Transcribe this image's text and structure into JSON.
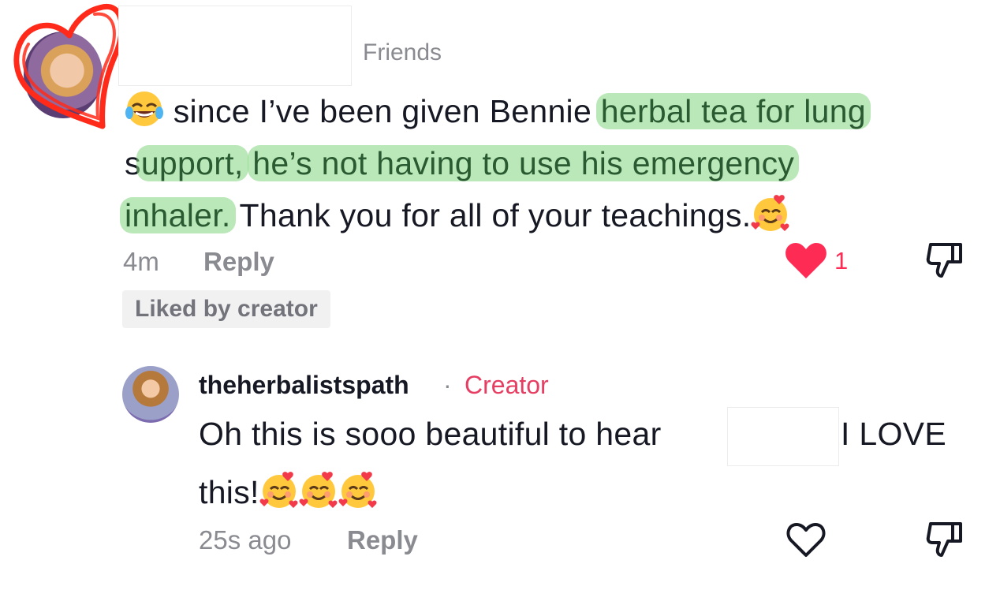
{
  "top_comment": {
    "author_label": "Friends",
    "text": {
      "l1_pre": " since I’ve been given Bennie ",
      "l1_hl": "herbal tea for lung",
      "l2_pre": "s",
      "l2_hl1": "upport,",
      "l2_mid": " ",
      "l2_hl2": "he’s not having to use his emergency",
      "l3_hl": "inhaler.",
      "l3_post": " Thank you for all of your teachings."
    },
    "time": "4m",
    "reply_label": "Reply",
    "like_count": "1",
    "liked_badge": "Liked by creator",
    "emojis": [
      "laughing-tears-emoji",
      "smiling-face-with-hearts-emoji"
    ]
  },
  "reply_comment": {
    "author": "theherbalistspath",
    "separator": "·",
    "role": "Creator",
    "line1": "Oh this is sooo beautiful to hear",
    "line1_end": "I LOVE",
    "line2": "this!",
    "time": "25s ago",
    "reply_label": "Reply",
    "emojis": [
      "smiling-face-with-hearts-emoji",
      "smiling-face-with-hearts-emoji",
      "smiling-face-with-hearts-emoji"
    ]
  },
  "colors": {
    "accent_red": "#fe2c55",
    "creator_pink": "#e63e62",
    "highlight_green": "#82d67e",
    "muted_gray": "#8a8b91"
  }
}
